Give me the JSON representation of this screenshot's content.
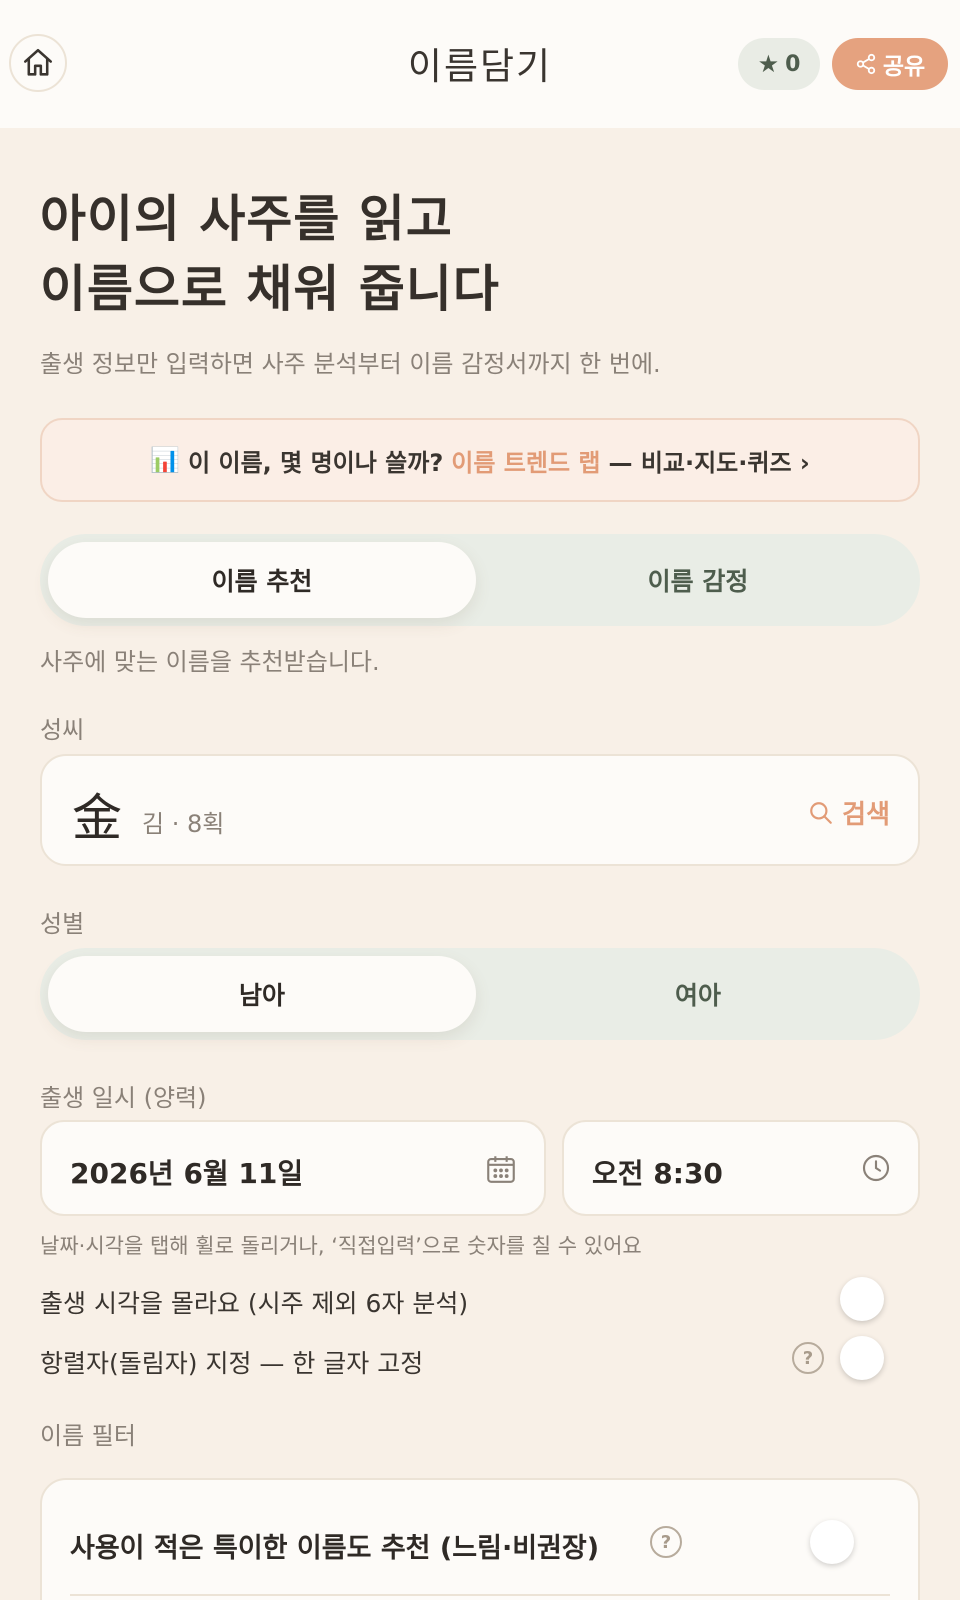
{
  "header": {
    "title": "이름담기",
    "favorites_count": "0",
    "share_label": "공유",
    "home_icon": "home-icon",
    "star_icon": "star-icon",
    "share_icon": "share-icon"
  },
  "hero": {
    "title_line1": "아이의 사주를 읽고",
    "title_line2": "이름으로 채워 줍니다",
    "subtitle": "출생 정보만 입력하면 사주 분석부터 이름 감정서까지 한 번에."
  },
  "trend_banner": {
    "emoji": "📊",
    "question": "이 이름, 몇 명이나 쓸까?",
    "link_label": "이름 트렌드 랩",
    "suffix": "— 비교·지도·퀴즈 ›"
  },
  "mode_tabs": {
    "items": [
      "이름 추천",
      "이름 감정"
    ],
    "selected": "이름 추천",
    "description": "사주에 맞는 이름을 추천받습니다."
  },
  "surname": {
    "label": "성씨",
    "hanja": "金",
    "meta": "김 · 8획",
    "search_label": "검색"
  },
  "gender": {
    "label": "성별",
    "options": [
      "남아",
      "여아"
    ],
    "selected": "남아"
  },
  "birth": {
    "label": "출생 일시 (양력)",
    "date_value": "2026년 6월 11일",
    "time_value": "오전 8:30",
    "hint": "날짜·시각을 탭해 휠로 돌리거나, ‘직접입력’으로 숫자를 칠 수 있어요"
  },
  "toggles": {
    "unknown_time_label": "출생 시각을 몰라요 (시주 제외 6자 분석)",
    "unknown_time_on": false,
    "generation_char_label": "항렬자(돌림자) 지정 — 한 글자 고정",
    "generation_char_on": false
  },
  "filter": {
    "label": "이름 필터",
    "rare_names_label": "사용이 적은 특이한 이름도 추천 (느림·비권장)",
    "rare_names_on": false
  },
  "colors": {
    "background": "#f8f0e7",
    "accent": "#e29b76",
    "segment_bg": "#e9ede6",
    "text_primary": "#2f2a26"
  }
}
